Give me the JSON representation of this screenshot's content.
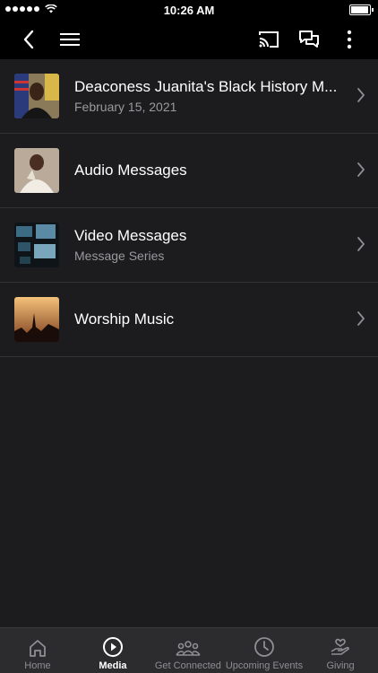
{
  "status": {
    "time": "10:26 AM"
  },
  "items": [
    {
      "title": "Deaconess Juanita's Black History M...",
      "subtitle": "February 15, 2021",
      "thumb": "portrait"
    },
    {
      "title": "Audio Messages",
      "subtitle": "",
      "thumb": "speaker"
    },
    {
      "title": "Video Messages",
      "subtitle": "Message Series",
      "thumb": "screens"
    },
    {
      "title": "Worship Music",
      "subtitle": "",
      "thumb": "concert"
    }
  ],
  "tabs": [
    {
      "label": "Home",
      "icon": "home-icon",
      "active": false
    },
    {
      "label": "Media",
      "icon": "play-icon",
      "active": true
    },
    {
      "label": "Get Connected",
      "icon": "people-icon",
      "active": false
    },
    {
      "label": "Upcoming Events",
      "icon": "clock-icon",
      "active": false
    },
    {
      "label": "Giving",
      "icon": "heart-hand-icon",
      "active": false
    }
  ]
}
